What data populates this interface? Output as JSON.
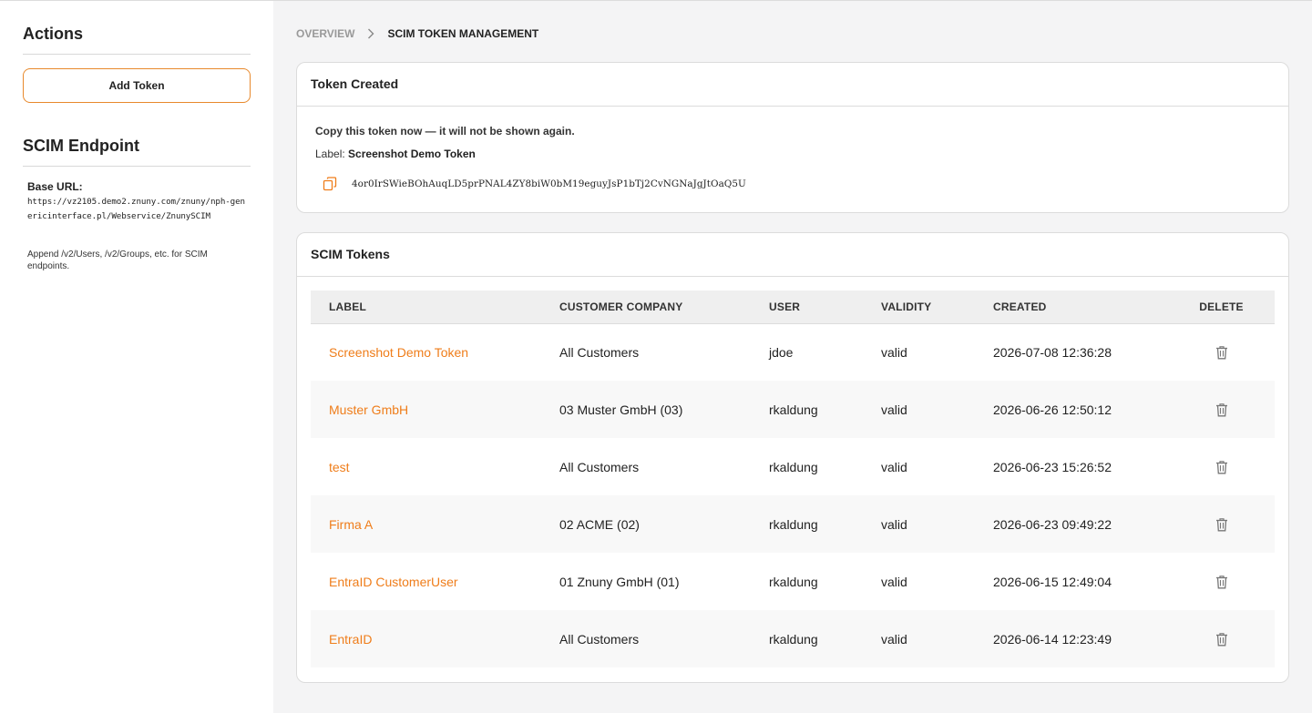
{
  "sidebar": {
    "actions_title": "Actions",
    "add_token_label": "Add Token",
    "endpoint_title": "SCIM Endpoint",
    "base_url_label": "Base URL:",
    "base_url": "https://vz2105.demo2.znuny.com/znuny/nph-genericinterface.pl/Webservice/ZnunySCIM",
    "append_note": "Append /v2/Users, /v2/Groups, etc. for SCIM endpoints."
  },
  "breadcrumb": {
    "overview": "OVERVIEW",
    "current": "SCIM TOKEN MANAGEMENT"
  },
  "token_created": {
    "title": "Token Created",
    "warning": "Copy this token now — it will not be shown again.",
    "label_prefix": "Label:",
    "label_value": "Screenshot Demo Token",
    "token": "4or0IrSWieBOhAuqLD5prPNAL4ZY8biW0bM19eguyJsP1bTj2CvNGNaJgJtOaQ5U"
  },
  "scim_tokens": {
    "title": "SCIM Tokens",
    "columns": {
      "label": "LABEL",
      "company": "CUSTOMER COMPANY",
      "user": "USER",
      "validity": "VALIDITY",
      "created": "CREATED",
      "delete": "DELETE"
    },
    "rows": [
      {
        "label": "Screenshot Demo Token",
        "company": "All Customers",
        "user": "jdoe",
        "validity": "valid",
        "created": "2026-07-08 12:36:28"
      },
      {
        "label": "Muster GmbH",
        "company": "03 Muster GmbH (03)",
        "user": "rkaldung",
        "validity": "valid",
        "created": "2026-06-26 12:50:12"
      },
      {
        "label": "test",
        "company": "All Customers",
        "user": "rkaldung",
        "validity": "valid",
        "created": "2026-06-23 15:26:52"
      },
      {
        "label": "Firma A",
        "company": "02 ACME (02)",
        "user": "rkaldung",
        "validity": "valid",
        "created": "2026-06-23 09:49:22"
      },
      {
        "label": "EntraID CustomerUser",
        "company": "01 Znuny GmbH (01)",
        "user": "rkaldung",
        "validity": "valid",
        "created": "2026-06-15 12:49:04"
      },
      {
        "label": "EntraID",
        "company": "All Customers",
        "user": "rkaldung",
        "validity": "valid",
        "created": "2026-06-14 12:23:49"
      }
    ]
  },
  "colors": {
    "accent": "#ef7d1a",
    "button_border": "#e8892c",
    "background": "#f4f4f5"
  },
  "icons": {
    "breadcrumb_separator": "chevron-right-icon",
    "copy": "copy-icon",
    "delete": "trash-icon"
  }
}
